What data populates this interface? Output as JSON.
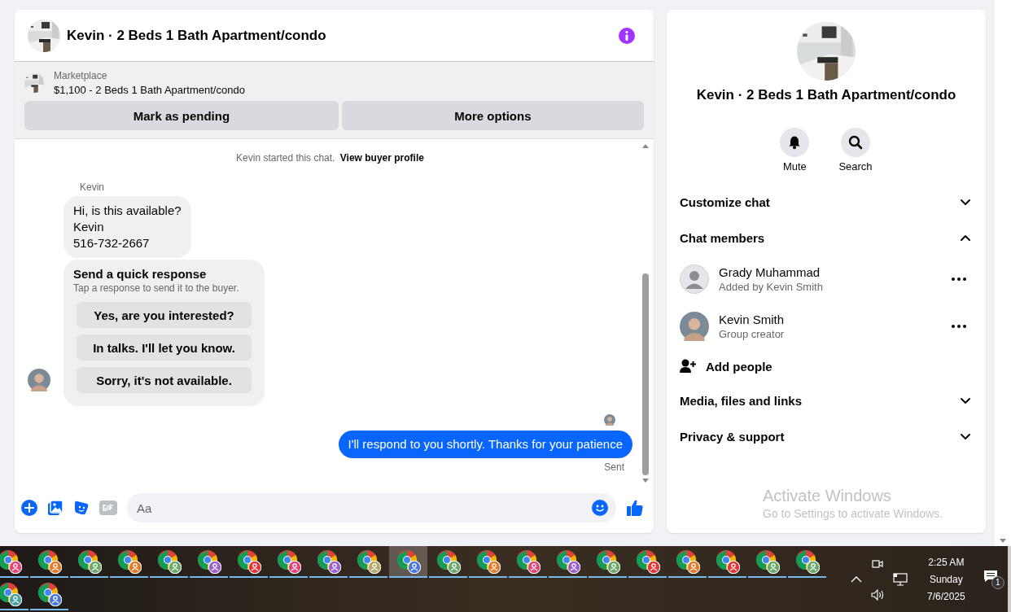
{
  "header": {
    "title": "Kevin · 2 Beds 1 Bath Apartment/condo"
  },
  "listing": {
    "source": "Marketplace",
    "title": "$1,100 - 2 Beds 1 Bath Apartment/condo",
    "buttons": [
      "Mark as pending",
      "More options"
    ]
  },
  "chat": {
    "notice": "Kevin started this chat.",
    "notice_link": "View buyer profile",
    "messages": [
      {
        "kind": "incoming",
        "sender": "Kevin",
        "lines": [
          "Hi, is this available?",
          "Kevin",
          "516-732-2667"
        ]
      },
      {
        "kind": "quick_response",
        "title": "Send a quick response",
        "subtitle": "Tap a response to send it to the buyer.",
        "options": [
          "Yes, are you interested?",
          "In talks. I'll let you know.",
          "Sorry, it's not available."
        ]
      },
      {
        "kind": "outgoing",
        "text": "I'll respond to you shortly. Thanks for your patience",
        "status": "Sent"
      }
    ]
  },
  "composer": {
    "placeholder": "Aa"
  },
  "details": {
    "title": "Kevin · 2 Beds 1 Bath Apartment/condo",
    "actions": [
      {
        "kind": "mute",
        "label": "Mute"
      },
      {
        "kind": "search",
        "label": "Search"
      }
    ],
    "sections": [
      {
        "label": "Customize chat",
        "expanded": false
      },
      {
        "label": "Chat members",
        "expanded": true,
        "members": [
          {
            "kind": "default",
            "name": "Grady Muhammad",
            "role": "Added by Kevin Smith"
          },
          {
            "name": "Kevin Smith",
            "role": "Group creator"
          }
        ],
        "add_label": "Add people"
      },
      {
        "label": "Media, files and links",
        "expanded": false
      },
      {
        "label": "Privacy & support",
        "expanded": false
      }
    ]
  },
  "activation": {
    "title": "Activate Windows",
    "subtitle": "Go to Settings to activate Windows."
  },
  "taskbar": {
    "apps": [
      {
        "color": "#e0457b",
        "selected": false
      },
      {
        "color": "#e07b2a",
        "selected": false
      },
      {
        "color": "#6aa96a",
        "selected": false
      },
      {
        "color": "#e07b2a",
        "selected": false
      },
      {
        "color": "#6aa96a",
        "selected": false
      },
      {
        "color": "#9b5fd0",
        "selected": false
      },
      {
        "color": "#e0383a",
        "selected": false
      },
      {
        "color": "#e0457b",
        "selected": false
      },
      {
        "color": "#9b5fd0",
        "selected": false
      },
      {
        "color": "#b3a86a",
        "selected": false
      },
      {
        "color": "#4a78d8",
        "selected": true
      },
      {
        "color": "#6aa96a",
        "selected": false
      },
      {
        "color": "#e07b2a",
        "selected": false
      },
      {
        "color": "#e0457b",
        "selected": false
      },
      {
        "color": "#9b5fd0",
        "selected": false
      },
      {
        "color": "#6aa96a",
        "selected": false
      },
      {
        "color": "#e0383a",
        "selected": false
      },
      {
        "color": "#e07b2a",
        "selected": false
      },
      {
        "color": "#e0383a",
        "selected": false
      },
      {
        "color": "#6aa96a",
        "selected": false
      },
      {
        "color": "#6aa96a",
        "selected": false
      },
      {
        "color": "#4aa0a0",
        "selected": false
      },
      {
        "color": "#4a78d8",
        "selected": false
      }
    ],
    "time": "2:25 AM",
    "day": "Sunday",
    "date": "7/6/2025",
    "notifications": "1"
  }
}
